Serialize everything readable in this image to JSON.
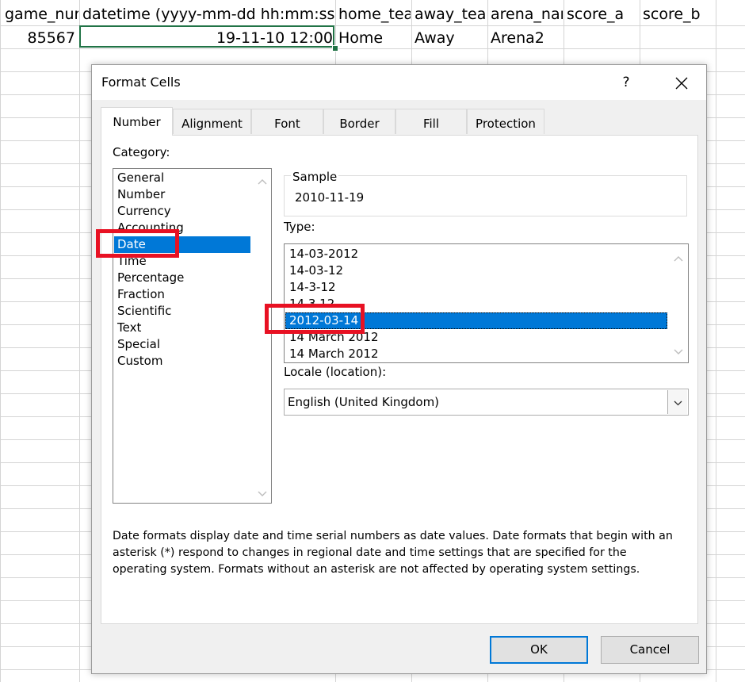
{
  "spreadsheet": {
    "headers": [
      "game_nur",
      "datetime (yyyy-mm-dd hh:mm:ss)",
      "home_tea",
      "away_tear",
      "arena_nar",
      "score_a",
      "score_b"
    ],
    "row1": [
      "85567",
      "19-11-10 12:00",
      "Home",
      "Away",
      "Arena2",
      "",
      ""
    ]
  },
  "dialog": {
    "title": "Format Cells",
    "help_label": "?",
    "tabs": [
      "Number",
      "Alignment",
      "Font",
      "Border",
      "Fill",
      "Protection"
    ],
    "active_tab": "Number",
    "category_label": "Category:",
    "categories": [
      "General",
      "Number",
      "Currency",
      "Accounting",
      "Date",
      "Time",
      "Percentage",
      "Fraction",
      "Scientific",
      "Text",
      "Special",
      "Custom"
    ],
    "selected_category": "Date",
    "sample_label": "Sample",
    "sample_value": "2010-11-19",
    "type_label": "Type:",
    "types": [
      "14-03-2012",
      "14-03-12",
      "14-3-12",
      "14.3.12",
      "2012-03-14",
      "14 March 2012",
      "14 March 2012"
    ],
    "selected_type": "2012-03-14",
    "locale_label": "Locale (location):",
    "locale_value": "English (United Kingdom)",
    "description": "Date formats display date and time serial numbers as date values.  Date formats that begin with an asterisk (*) respond to changes in regional date and time settings that are specified for the operating system. Formats without an asterisk are not affected by operating system settings.",
    "ok_label": "OK",
    "cancel_label": "Cancel"
  },
  "colors": {
    "selection": "#0078d7",
    "annotation": "#e81123",
    "active_cell_border": "#217346"
  }
}
